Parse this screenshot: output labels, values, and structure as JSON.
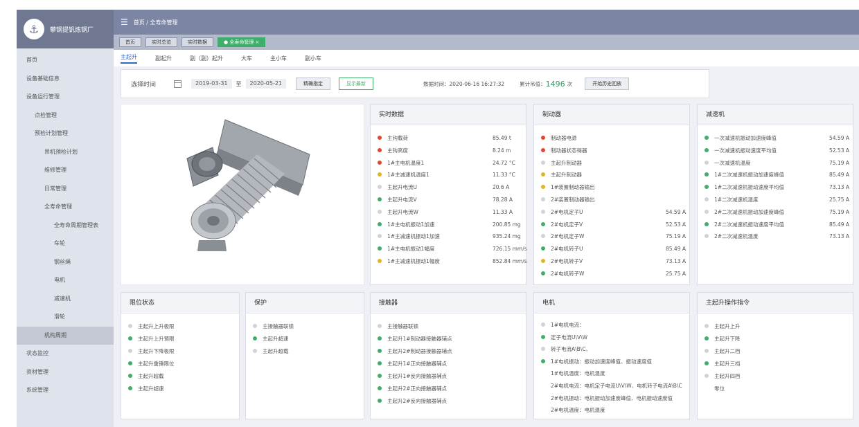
{
  "app": {
    "logo_text": "攀钢提钒炼钢厂",
    "logo_icon": "crane-logo-icon"
  },
  "sidebar": {
    "items": [
      {
        "label": "首页",
        "level": 1
      },
      {
        "label": "设备基础信息",
        "level": 1
      },
      {
        "label": "设备运行管理",
        "level": 1
      },
      {
        "label": "点检管理",
        "level": 2
      },
      {
        "label": "预检计划管理",
        "level": 2
      },
      {
        "label": "吊机预检计划",
        "level": 3
      },
      {
        "label": "维修管理",
        "level": 3
      },
      {
        "label": "日常管理",
        "level": 3
      },
      {
        "label": "全寿命管理",
        "level": 3
      },
      {
        "label": "全寿命周期管理表",
        "level": 4
      },
      {
        "label": "车轮",
        "level": 4
      },
      {
        "label": "钢丝绳",
        "level": 4
      },
      {
        "label": "电机",
        "level": 4
      },
      {
        "label": "减速机",
        "level": 4
      },
      {
        "label": "滑轮",
        "level": 4
      },
      {
        "label": "机构周期",
        "level": 3,
        "active": true
      },
      {
        "label": "状态监控",
        "level": 1
      },
      {
        "label": "资材管理",
        "level": 1
      },
      {
        "label": "系统管理",
        "level": 1
      }
    ]
  },
  "topbar": {
    "breadcrumb": "首页 / 全寿命管理",
    "menu_icon": "menu-icon"
  },
  "tags": [
    {
      "label": "首页"
    },
    {
      "label": "实时总览"
    },
    {
      "label": "实时数据"
    },
    {
      "label": "● 全寿命管理 ×",
      "active": true
    }
  ],
  "subtabs": [
    {
      "label": "主起升",
      "active": true
    },
    {
      "label": "副起升"
    },
    {
      "label": "副（副）起升"
    },
    {
      "label": "大车"
    },
    {
      "label": "主小车"
    },
    {
      "label": "副小车"
    }
  ],
  "filter": {
    "label": "选择时间",
    "calendar_icon": "calendar-icon",
    "start": "2019-03-31",
    "to": "至",
    "end": "2020-05-21",
    "btn_precise": "精确指定",
    "btn_latest": "显示最新",
    "data_time_label": "数据时间：",
    "data_time": "2020-06-16 16:27:32",
    "cumulative_label": "累计吊值：",
    "cumulative_value": "1496",
    "cumulative_unit": "次",
    "btn_history": "开始历史回放"
  },
  "colors": {
    "red": "#e0482f",
    "green": "#3fae6a",
    "yellow": "#e6b320",
    "gray": "#cfd3da",
    "accent": "#3466c8",
    "sidebar_header": "#6f7890"
  },
  "panels": {
    "realtime": {
      "title": "实时数据",
      "rows": [
        {
          "label": "主钩载荷",
          "value": "85.49 t",
          "status": "red"
        },
        {
          "label": "主钩高度",
          "value": "8.24 m",
          "status": "red"
        },
        {
          "label": "1#主电机温度1",
          "value": "24.72 °C",
          "status": "red"
        },
        {
          "label": "1#主减速机温度1",
          "value": "11.33 °C",
          "status": "yellow"
        },
        {
          "label": "主起升电流U",
          "value": "20.6 A",
          "status": "gray"
        },
        {
          "label": "主起升电流V",
          "value": "78.28 A",
          "status": "green"
        },
        {
          "label": "主起升电流W",
          "value": "11.33 A",
          "status": "gray"
        },
        {
          "label": "1#主电机振动1加速",
          "value": "200.85 mg",
          "status": "green"
        },
        {
          "label": "1#主减速机振动1加速",
          "value": "935.24 mg",
          "status": "gray"
        },
        {
          "label": "1#主电机振动1幅度",
          "value": "726.15 mm/s",
          "status": "green"
        },
        {
          "label": "1#主减速机振动1幅度",
          "value": "852.84 mm/s",
          "status": "yellow"
        }
      ]
    },
    "brake": {
      "title": "制动器",
      "rows": [
        {
          "label": "制动器电源",
          "value": "",
          "status": "red"
        },
        {
          "label": "制动器状态得器",
          "value": "",
          "status": "red"
        },
        {
          "label": "主起升制动器",
          "value": "",
          "status": "gray"
        },
        {
          "label": "主起升制动器",
          "value": "",
          "status": "yellow"
        },
        {
          "label": "1#装置制动器输出",
          "value": "",
          "status": "yellow"
        },
        {
          "label": "2#装置制动器输出",
          "value": "",
          "status": "gray"
        },
        {
          "label": "2#电机定子U",
          "value": "54.59 A",
          "status": "gray"
        },
        {
          "label": "2#电机定子V",
          "value": "52.53 A",
          "status": "green"
        },
        {
          "label": "2#电机定子W",
          "value": "75.19 A",
          "status": "gray"
        },
        {
          "label": "2#电机转子U",
          "value": "85.49 A",
          "status": "green"
        },
        {
          "label": "2#电机转子V",
          "value": "73.13 A",
          "status": "yellow"
        },
        {
          "label": "2#电机转子W",
          "value": "25.75 A",
          "status": "green"
        }
      ]
    },
    "reducer": {
      "title": "减速机",
      "rows": [
        {
          "label": "一次减速机振动加速度峰值",
          "value": "54.59 A",
          "status": "green"
        },
        {
          "label": "一次减速机振动速度平均值",
          "value": "52.53 A",
          "status": "green"
        },
        {
          "label": "一次减速机温度",
          "value": "75.19 A",
          "status": "gray"
        },
        {
          "label": "1#二次减速机振动加速度峰值",
          "value": "85.49 A",
          "status": "green"
        },
        {
          "label": "1#二次减速机振动速度平均值",
          "value": "73.13 A",
          "status": "green"
        },
        {
          "label": "1#二次减速机温度",
          "value": "25.75 A",
          "status": "gray"
        },
        {
          "label": "2#二次减速机振动加速度峰值",
          "value": "75.19 A",
          "status": "gray"
        },
        {
          "label": "2#二次减速机振动速度平均值",
          "value": "85.49 A",
          "status": "green"
        },
        {
          "label": "2#二次减速机温度",
          "value": "73.13 A",
          "status": "gray"
        }
      ]
    },
    "limit": {
      "title": "限位状态",
      "rows": [
        {
          "label": "主起升上升极限",
          "status": "gray"
        },
        {
          "label": "主起升上升预限",
          "status": "green"
        },
        {
          "label": "主起升下降极限",
          "status": "gray"
        },
        {
          "label": "主起升重锤限位",
          "status": "green"
        },
        {
          "label": "主起升超载",
          "status": "green"
        },
        {
          "label": "主起升超速",
          "status": "green"
        }
      ]
    },
    "protect": {
      "title": "保护",
      "rows": [
        {
          "label": "主接触器联锁",
          "status": "gray"
        },
        {
          "label": "主起升超速",
          "status": "green"
        },
        {
          "label": "主起升超载",
          "status": "gray"
        }
      ]
    },
    "contactor": {
      "title": "接触器",
      "rows": [
        {
          "label": "主接触器联锁",
          "status": "gray"
        },
        {
          "label": "主起升1#制动器接触器辅点",
          "status": "green"
        },
        {
          "label": "主起升2#制动器接触器辅点",
          "status": "green"
        },
        {
          "label": "主起升1#正向接触器辅点",
          "status": "green"
        },
        {
          "label": "主起升1#反向接触器辅点",
          "status": "green"
        },
        {
          "label": "主起升2#正向接触器辅点",
          "status": "green"
        },
        {
          "label": "主起升2#反向接触器辅点",
          "status": "green"
        }
      ]
    },
    "motor": {
      "title": "电机",
      "rows": [
        {
          "label": "1#电机电流：",
          "status": "gray"
        },
        {
          "label": "定子电流U\\V\\W",
          "status": "green"
        },
        {
          "label": "转子电流A\\B\\C、",
          "status": "gray"
        },
        {
          "label": "1#电机振动：振动加速度峰值、振动速度值",
          "status": "green"
        },
        {
          "label": "1#电机温度：电机温度",
          "status": "none"
        },
        {
          "label": "2#电机电流：电机定子电流U\\V\\W、电机转子电流A\\B\\C",
          "status": "none"
        },
        {
          "label": "2#电机振动：电机振动加速度峰值、电机振动速度值",
          "status": "none"
        },
        {
          "label": "2#电机温度：电机温度",
          "status": "none"
        }
      ]
    },
    "command": {
      "title": "主起升操作指令",
      "rows": [
        {
          "label": "主起升上升",
          "status": "gray"
        },
        {
          "label": "主起升下降",
          "status": "green"
        },
        {
          "label": "主起升二档",
          "status": "gray"
        },
        {
          "label": "主起升三档",
          "status": "green"
        },
        {
          "label": "主起升四档",
          "status": "gray"
        },
        {
          "label": "零位",
          "status": "none"
        }
      ]
    }
  }
}
